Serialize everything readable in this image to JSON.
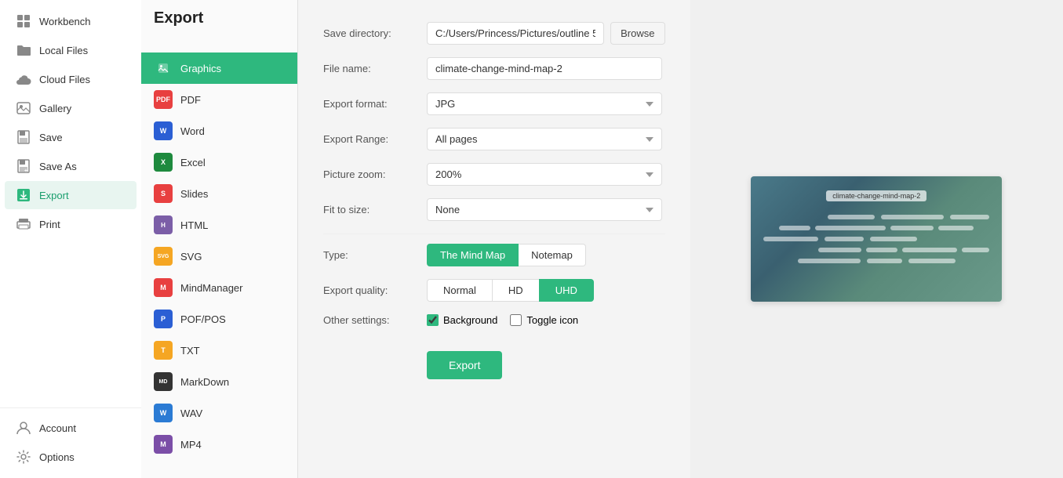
{
  "sidebar": {
    "title": "Workbench",
    "items": [
      {
        "id": "workbench",
        "label": "Workbench",
        "icon": "grid"
      },
      {
        "id": "local-files",
        "label": "Local Files",
        "icon": "folder"
      },
      {
        "id": "cloud-files",
        "label": "Cloud Files",
        "icon": "cloud"
      },
      {
        "id": "gallery",
        "label": "Gallery",
        "icon": "gallery"
      },
      {
        "id": "save",
        "label": "Save",
        "icon": "save"
      },
      {
        "id": "save-as",
        "label": "Save As",
        "icon": "save-as"
      },
      {
        "id": "export",
        "label": "Export",
        "icon": "export",
        "active": true
      },
      {
        "id": "print",
        "label": "Print",
        "icon": "print"
      }
    ],
    "bottom": [
      {
        "id": "account",
        "label": "Account",
        "icon": "user"
      },
      {
        "id": "options",
        "label": "Options",
        "icon": "gear"
      }
    ]
  },
  "export_panel": {
    "title": "Export",
    "formats": [
      {
        "id": "graphics",
        "label": "Graphics",
        "color": "#2eb87e",
        "active": true,
        "abbr": "IMG"
      },
      {
        "id": "pdf",
        "label": "PDF",
        "color": "#e84040",
        "abbr": "PDF"
      },
      {
        "id": "word",
        "label": "Word",
        "color": "#2b5fd4",
        "abbr": "W"
      },
      {
        "id": "excel",
        "label": "Excel",
        "color": "#1e8a3e",
        "abbr": "X"
      },
      {
        "id": "slides",
        "label": "Slides",
        "color": "#e84040",
        "abbr": "S"
      },
      {
        "id": "html",
        "label": "HTML",
        "color": "#7b5ea7",
        "abbr": "H"
      },
      {
        "id": "svg",
        "label": "SVG",
        "color": "#f5a623",
        "abbr": "SVG"
      },
      {
        "id": "mindmanager",
        "label": "MindManager",
        "color": "#e84040",
        "abbr": "M"
      },
      {
        "id": "pofpos",
        "label": "POF/POS",
        "color": "#2b5fd4",
        "abbr": "P"
      },
      {
        "id": "txt",
        "label": "TXT",
        "color": "#f5a623",
        "abbr": "T"
      },
      {
        "id": "markdown",
        "label": "MarkDown",
        "color": "#333",
        "abbr": "MD"
      },
      {
        "id": "wav",
        "label": "WAV",
        "color": "#2b7bd4",
        "abbr": "W"
      },
      {
        "id": "mp4",
        "label": "MP4",
        "color": "#7b4ea7",
        "abbr": "M"
      }
    ],
    "fields": {
      "save_directory_label": "Save directory:",
      "save_directory_value": "C:/Users/Princess/Pictures/outline 5",
      "browse_label": "Browse",
      "file_name_label": "File name:",
      "file_name_value": "climate-change-mind-map-2",
      "export_format_label": "Export format:",
      "export_format_value": "JPG",
      "export_range_label": "Export Range:",
      "export_range_value": "All pages",
      "picture_zoom_label": "Picture zoom:",
      "picture_zoom_value": "200%",
      "fit_to_size_label": "Fit to size:",
      "fit_to_size_value": "None",
      "type_label": "Type:",
      "type_options": [
        {
          "label": "The Mind Map",
          "active": true
        },
        {
          "label": "Notemap",
          "active": false
        }
      ],
      "quality_label": "Export quality:",
      "quality_options": [
        {
          "label": "Normal",
          "active": false
        },
        {
          "label": "HD",
          "active": false
        },
        {
          "label": "UHD",
          "active": true
        }
      ],
      "other_settings_label": "Other settings:",
      "background_label": "Background",
      "background_checked": true,
      "toggle_icon_label": "Toggle icon",
      "toggle_icon_checked": false,
      "export_button": "Export"
    }
  },
  "preview": {
    "title": "climate-change-mind-map-2"
  }
}
